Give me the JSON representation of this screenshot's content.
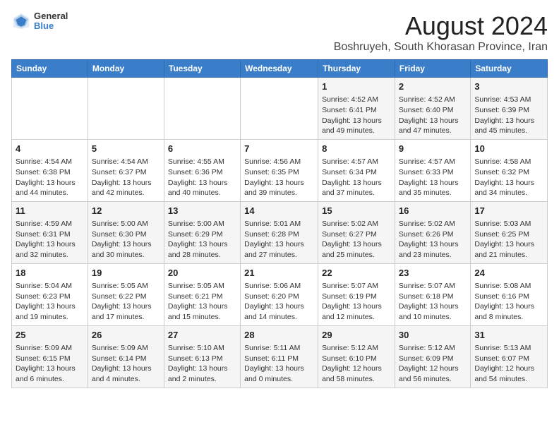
{
  "logo": {
    "general": "General",
    "blue": "Blue"
  },
  "title": {
    "month_year": "August 2024",
    "location": "Boshruyeh, South Khorasan Province, Iran"
  },
  "days_of_week": [
    "Sunday",
    "Monday",
    "Tuesday",
    "Wednesday",
    "Thursday",
    "Friday",
    "Saturday"
  ],
  "weeks": [
    [
      {
        "day": "",
        "content": ""
      },
      {
        "day": "",
        "content": ""
      },
      {
        "day": "",
        "content": ""
      },
      {
        "day": "",
        "content": ""
      },
      {
        "day": "1",
        "content": "Sunrise: 4:52 AM\nSunset: 6:41 PM\nDaylight: 13 hours\nand 49 minutes."
      },
      {
        "day": "2",
        "content": "Sunrise: 4:52 AM\nSunset: 6:40 PM\nDaylight: 13 hours\nand 47 minutes."
      },
      {
        "day": "3",
        "content": "Sunrise: 4:53 AM\nSunset: 6:39 PM\nDaylight: 13 hours\nand 45 minutes."
      }
    ],
    [
      {
        "day": "4",
        "content": "Sunrise: 4:54 AM\nSunset: 6:38 PM\nDaylight: 13 hours\nand 44 minutes."
      },
      {
        "day": "5",
        "content": "Sunrise: 4:54 AM\nSunset: 6:37 PM\nDaylight: 13 hours\nand 42 minutes."
      },
      {
        "day": "6",
        "content": "Sunrise: 4:55 AM\nSunset: 6:36 PM\nDaylight: 13 hours\nand 40 minutes."
      },
      {
        "day": "7",
        "content": "Sunrise: 4:56 AM\nSunset: 6:35 PM\nDaylight: 13 hours\nand 39 minutes."
      },
      {
        "day": "8",
        "content": "Sunrise: 4:57 AM\nSunset: 6:34 PM\nDaylight: 13 hours\nand 37 minutes."
      },
      {
        "day": "9",
        "content": "Sunrise: 4:57 AM\nSunset: 6:33 PM\nDaylight: 13 hours\nand 35 minutes."
      },
      {
        "day": "10",
        "content": "Sunrise: 4:58 AM\nSunset: 6:32 PM\nDaylight: 13 hours\nand 34 minutes."
      }
    ],
    [
      {
        "day": "11",
        "content": "Sunrise: 4:59 AM\nSunset: 6:31 PM\nDaylight: 13 hours\nand 32 minutes."
      },
      {
        "day": "12",
        "content": "Sunrise: 5:00 AM\nSunset: 6:30 PM\nDaylight: 13 hours\nand 30 minutes."
      },
      {
        "day": "13",
        "content": "Sunrise: 5:00 AM\nSunset: 6:29 PM\nDaylight: 13 hours\nand 28 minutes."
      },
      {
        "day": "14",
        "content": "Sunrise: 5:01 AM\nSunset: 6:28 PM\nDaylight: 13 hours\nand 27 minutes."
      },
      {
        "day": "15",
        "content": "Sunrise: 5:02 AM\nSunset: 6:27 PM\nDaylight: 13 hours\nand 25 minutes."
      },
      {
        "day": "16",
        "content": "Sunrise: 5:02 AM\nSunset: 6:26 PM\nDaylight: 13 hours\nand 23 minutes."
      },
      {
        "day": "17",
        "content": "Sunrise: 5:03 AM\nSunset: 6:25 PM\nDaylight: 13 hours\nand 21 minutes."
      }
    ],
    [
      {
        "day": "18",
        "content": "Sunrise: 5:04 AM\nSunset: 6:23 PM\nDaylight: 13 hours\nand 19 minutes."
      },
      {
        "day": "19",
        "content": "Sunrise: 5:05 AM\nSunset: 6:22 PM\nDaylight: 13 hours\nand 17 minutes."
      },
      {
        "day": "20",
        "content": "Sunrise: 5:05 AM\nSunset: 6:21 PM\nDaylight: 13 hours\nand 15 minutes."
      },
      {
        "day": "21",
        "content": "Sunrise: 5:06 AM\nSunset: 6:20 PM\nDaylight: 13 hours\nand 14 minutes."
      },
      {
        "day": "22",
        "content": "Sunrise: 5:07 AM\nSunset: 6:19 PM\nDaylight: 13 hours\nand 12 minutes."
      },
      {
        "day": "23",
        "content": "Sunrise: 5:07 AM\nSunset: 6:18 PM\nDaylight: 13 hours\nand 10 minutes."
      },
      {
        "day": "24",
        "content": "Sunrise: 5:08 AM\nSunset: 6:16 PM\nDaylight: 13 hours\nand 8 minutes."
      }
    ],
    [
      {
        "day": "25",
        "content": "Sunrise: 5:09 AM\nSunset: 6:15 PM\nDaylight: 13 hours\nand 6 minutes."
      },
      {
        "day": "26",
        "content": "Sunrise: 5:09 AM\nSunset: 6:14 PM\nDaylight: 13 hours\nand 4 minutes."
      },
      {
        "day": "27",
        "content": "Sunrise: 5:10 AM\nSunset: 6:13 PM\nDaylight: 13 hours\nand 2 minutes."
      },
      {
        "day": "28",
        "content": "Sunrise: 5:11 AM\nSunset: 6:11 PM\nDaylight: 13 hours\nand 0 minutes."
      },
      {
        "day": "29",
        "content": "Sunrise: 5:12 AM\nSunset: 6:10 PM\nDaylight: 12 hours\nand 58 minutes."
      },
      {
        "day": "30",
        "content": "Sunrise: 5:12 AM\nSunset: 6:09 PM\nDaylight: 12 hours\nand 56 minutes."
      },
      {
        "day": "31",
        "content": "Sunrise: 5:13 AM\nSunset: 6:07 PM\nDaylight: 12 hours\nand 54 minutes."
      }
    ]
  ]
}
